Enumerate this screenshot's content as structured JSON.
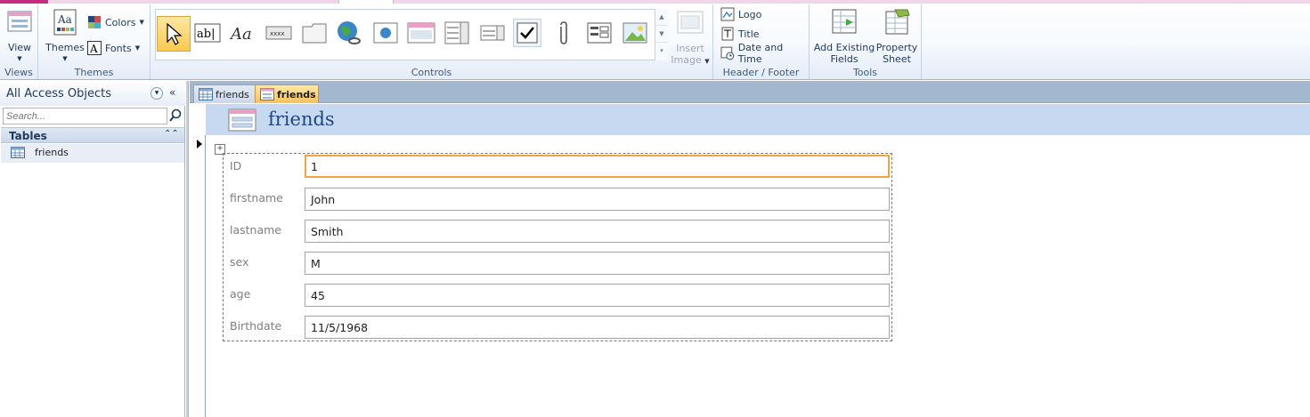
{
  "ribbon": {
    "groups": {
      "views": "Views",
      "themes": "Themes",
      "controls": "Controls",
      "header_footer": "Header / Footer",
      "tools": "Tools"
    },
    "view_label": "View",
    "themes_label": "Themes",
    "colors_label": "Colors",
    "fonts_label": "Fonts",
    "insert_image_line1": "Insert",
    "insert_image_line2": "Image",
    "logo_label": "Logo",
    "title_label": "Title",
    "date_time_label": "Date and Time",
    "add_fields_line1": "Add Existing",
    "add_fields_line2": "Fields",
    "property_sheet_line1": "Property",
    "property_sheet_line2": "Sheet",
    "accent_color": "#c42d7d"
  },
  "nav": {
    "title": "All Access Objects",
    "search_placeholder": "Search...",
    "category": "Tables",
    "items": [
      {
        "label": "friends",
        "icon": "table-icon"
      }
    ]
  },
  "tabs": [
    {
      "label": "friends",
      "icon": "table-icon",
      "active": false
    },
    {
      "label": "friends",
      "icon": "form-icon",
      "active": true
    }
  ],
  "form": {
    "title": "friends",
    "fields": [
      {
        "label": "ID",
        "value": "1"
      },
      {
        "label": "firstname",
        "value": "John"
      },
      {
        "label": "lastname",
        "value": "Smith"
      },
      {
        "label": "sex",
        "value": "M"
      },
      {
        "label": "age",
        "value": "45"
      },
      {
        "label": "Birthdate",
        "value": "11/5/1968"
      }
    ]
  }
}
